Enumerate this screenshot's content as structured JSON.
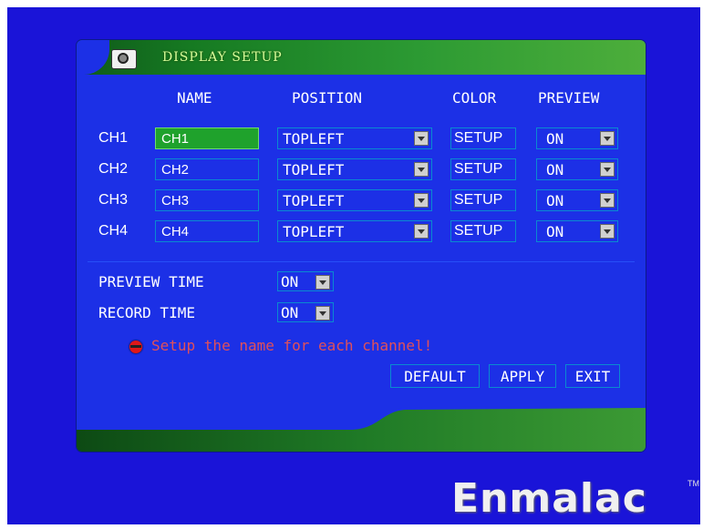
{
  "window": {
    "title": "DISPLAY SETUP"
  },
  "headers": {
    "name": "NAME",
    "position": "POSITION",
    "color": "COLOR",
    "preview": "PREVIEW"
  },
  "channels": [
    {
      "label": "CH1",
      "name": "CH1",
      "position": "TOPLEFT",
      "color": "SETUP",
      "preview": "ON",
      "selected": true
    },
    {
      "label": "CH2",
      "name": "CH2",
      "position": "TOPLEFT",
      "color": "SETUP",
      "preview": "ON",
      "selected": false
    },
    {
      "label": "CH3",
      "name": "CH3",
      "position": "TOPLEFT",
      "color": "SETUP",
      "preview": "ON",
      "selected": false
    },
    {
      "label": "CH4",
      "name": "CH4",
      "position": "TOPLEFT",
      "color": "SETUP",
      "preview": "ON",
      "selected": false
    }
  ],
  "options": {
    "preview_time_label": "PREVIEW TIME",
    "preview_time_value": "ON",
    "record_time_label": "RECORD TIME",
    "record_time_value": "ON"
  },
  "hint": "Setup the name for each channel!",
  "buttons": {
    "default": "DEFAULT",
    "apply": "APPLY",
    "exit": "EXIT"
  },
  "brand": {
    "name": "Enmalac",
    "tm": "TM"
  },
  "icons": {
    "title_icon": "camera-icon",
    "hint_icon": "red-dot-icon"
  },
  "colors": {
    "background": "#1a14d8",
    "panel": "#1c30e6",
    "titlebar": "#2c9a33",
    "selected_field": "#1fa22c",
    "hint_text": "#e0505a"
  }
}
